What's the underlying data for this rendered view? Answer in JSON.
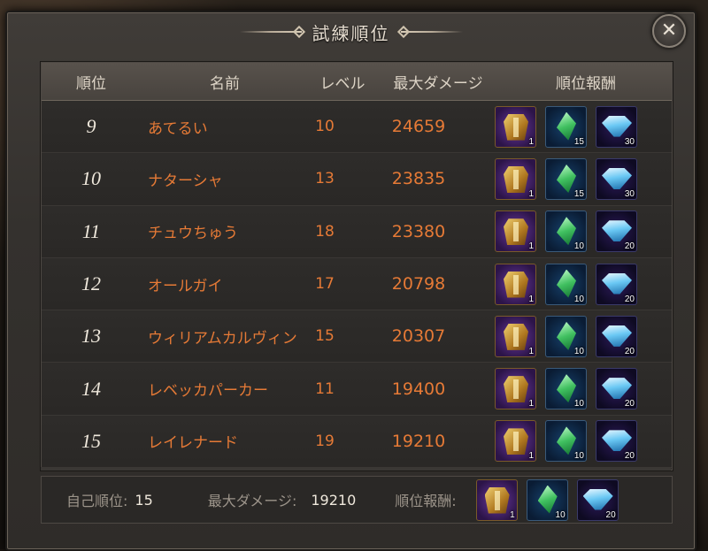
{
  "window": {
    "title": "試練順位"
  },
  "table": {
    "headers": {
      "rank": "順位",
      "name": "名前",
      "level": "レベル",
      "max_damage": "最大ダメージ",
      "reward": "順位報酬"
    },
    "rows": [
      {
        "rank": "9",
        "name": "あてるい",
        "level": "10",
        "damage": "24659",
        "rewards": [
          "1",
          "15",
          "30"
        ]
      },
      {
        "rank": "10",
        "name": "ナターシャ",
        "level": "13",
        "damage": "23835",
        "rewards": [
          "1",
          "15",
          "30"
        ]
      },
      {
        "rank": "11",
        "name": "チュウちゅう",
        "level": "18",
        "damage": "23380",
        "rewards": [
          "1",
          "10",
          "20"
        ]
      },
      {
        "rank": "12",
        "name": "オールガイ",
        "level": "17",
        "damage": "20798",
        "rewards": [
          "1",
          "10",
          "20"
        ]
      },
      {
        "rank": "13",
        "name": "ウィリアムカルヴィン",
        "level": "15",
        "damage": "20307",
        "rewards": [
          "1",
          "10",
          "20"
        ]
      },
      {
        "rank": "14",
        "name": "レベッカパーカー",
        "level": "11",
        "damage": "19400",
        "rewards": [
          "1",
          "10",
          "20"
        ]
      },
      {
        "rank": "15",
        "name": "レイレナード",
        "level": "19",
        "damage": "19210",
        "rewards": [
          "1",
          "10",
          "20"
        ]
      }
    ],
    "reward_icons": [
      "treasure-chest-icon",
      "green-crystal-icon",
      "blue-gem-icon"
    ]
  },
  "footer": {
    "self_rank_label": "自己順位:",
    "self_rank_value": "15",
    "max_damage_label": "最大ダメージ:",
    "max_damage_value": "19210",
    "reward_label": "順位報酬:",
    "rewards": [
      "1",
      "10",
      "20"
    ]
  },
  "colors": {
    "accent_orange": "#e67a36",
    "text_light": "#efe8dc"
  }
}
